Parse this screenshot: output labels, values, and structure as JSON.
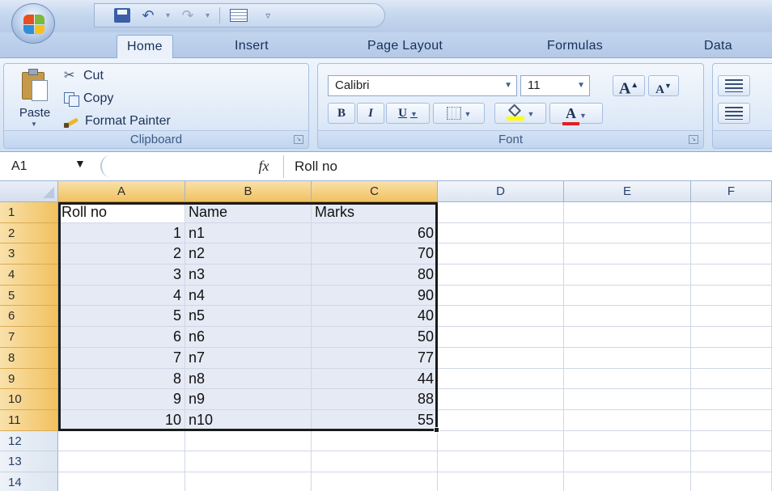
{
  "quick_access": {
    "icons": [
      "save-icon",
      "undo-icon",
      "redo-icon",
      "form-icon",
      "customize-icon"
    ]
  },
  "tabs": [
    {
      "label": "Home",
      "active": true
    },
    {
      "label": "Insert",
      "active": false
    },
    {
      "label": "Page Layout",
      "active": false
    },
    {
      "label": "Formulas",
      "active": false
    },
    {
      "label": "Data",
      "active": false
    }
  ],
  "clipboard": {
    "paste_label": "Paste",
    "cut_label": "Cut",
    "copy_label": "Copy",
    "format_painter_label": "Format Painter",
    "group_label": "Clipboard"
  },
  "font": {
    "font_name": "Calibri",
    "font_size": "11",
    "grow_label": "A",
    "shrink_label": "A",
    "bold_label": "B",
    "italic_label": "I",
    "underline_label": "U",
    "font_color_label": "A",
    "group_label": "Font",
    "highlight_color": "#ffff00",
    "font_color": "#e02020"
  },
  "formula_bar": {
    "name_box": "A1",
    "fx_label": "fx",
    "formula": "Roll no"
  },
  "sheet": {
    "columns": [
      "A",
      "B",
      "C",
      "D",
      "E",
      "F"
    ],
    "rows": [
      "1",
      "2",
      "3",
      "4",
      "5",
      "6",
      "7",
      "8",
      "9",
      "10",
      "11",
      "12",
      "13",
      "14"
    ],
    "data": [
      [
        "Roll no",
        "Name",
        "Marks"
      ],
      [
        "1",
        "n1",
        "60"
      ],
      [
        "2",
        "n2",
        "70"
      ],
      [
        "3",
        "n3",
        "80"
      ],
      [
        "4",
        "n4",
        "90"
      ],
      [
        "5",
        "n5",
        "40"
      ],
      [
        "6",
        "n6",
        "50"
      ],
      [
        "7",
        "n7",
        "77"
      ],
      [
        "8",
        "n8",
        "44"
      ],
      [
        "9",
        "n9",
        "88"
      ],
      [
        "10",
        "n10",
        "55"
      ]
    ],
    "selected_range": "A1:C11",
    "selection_header_color": "#f1c15f",
    "selection_fill_color": "#e5eaf5"
  }
}
